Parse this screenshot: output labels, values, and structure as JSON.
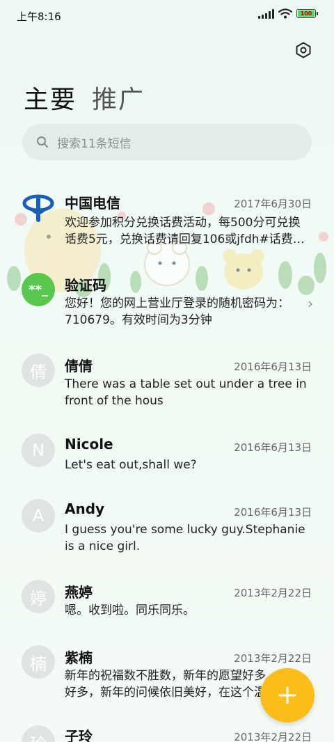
{
  "status_bar": {
    "time": "上午8:16",
    "battery": "100"
  },
  "tabs": [
    {
      "label": "主要",
      "active": true
    },
    {
      "label": "推广",
      "active": false
    }
  ],
  "search": {
    "placeholder": "搜索11条短信"
  },
  "messages": [
    {
      "sender": "中国电信",
      "date": "2017年6月30日",
      "preview": "欢迎参加积分兑换话费活动，每500分可兑换话费5元，兑换话费请回复106或jfdh#话费…",
      "avatar": "telecom-logo"
    },
    {
      "sender": "验证码",
      "date": "",
      "preview": "您好！您的网上营业厅登录的随机密码为：710679。有效时间为3分钟",
      "avatar_text": "**_",
      "avatar_color": "#57c84d"
    },
    {
      "sender": "倩倩",
      "date": "2016年6月13日",
      "preview": "There was a table set out under a tree in front of the hous",
      "avatar_text": "倩"
    },
    {
      "sender": "Nicole",
      "date": "2016年6月13日",
      "preview": "Let's eat out,shall we?",
      "avatar_text": "N"
    },
    {
      "sender": "Andy",
      "date": "2016年6月13日",
      "preview": "I guess you're some lucky guy.Stephanie is a nice girl.",
      "avatar_text": "A"
    },
    {
      "sender": "燕婷",
      "date": "2013年2月22日",
      "preview": "嗯。收到啦。同乐同乐。",
      "avatar_text": "婷"
    },
    {
      "sender": "紫楠",
      "date": "2013年2月22日",
      "preview": "新年的祝福数不胜数，新年的愿望好多好多，新年的问候依旧美好，在这个温馨的",
      "avatar_text": "楠"
    },
    {
      "sender": "子玲",
      "date": "2013年2月22日",
      "preview": "",
      "avatar_text": "玲"
    }
  ],
  "fab": {
    "label": "+"
  },
  "colors": {
    "accent": "#fbbd1a",
    "verify_green": "#57c84d",
    "telecom_blue": "#1a5fb4"
  }
}
